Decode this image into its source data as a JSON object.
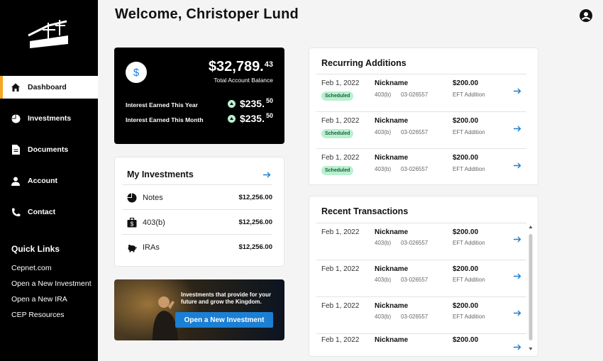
{
  "header": {
    "title": "Welcome, Christoper Lund"
  },
  "sidebar": {
    "items": [
      {
        "label": "Dashboard",
        "icon": "home-icon"
      },
      {
        "label": "Investments",
        "icon": "pie-chart-icon"
      },
      {
        "label": "Documents",
        "icon": "document-icon"
      },
      {
        "label": "Account",
        "icon": "user-icon"
      },
      {
        "label": "Contact",
        "icon": "phone-icon"
      }
    ],
    "quick_links_title": "Quick Links",
    "quick_links": [
      "Cepnet.com",
      "Open a New Investment",
      "Open a New IRA",
      "CEP Resources"
    ]
  },
  "balance": {
    "amount_main": "$32,789.",
    "amount_cents": "43",
    "label": "Total Account Balance",
    "year_label": "Interest Earned This Year",
    "year_main": "$235.",
    "year_cents": "50",
    "month_label": "Interest Earned This Month",
    "month_main": "$235.",
    "month_cents": "50"
  },
  "investments": {
    "title": "My Investments",
    "rows": [
      {
        "label": "Notes",
        "value": "$12,256.00",
        "icon": "pie-chart-icon"
      },
      {
        "label": "403(b)",
        "value": "$12,256.00",
        "icon": "briefcase-dollar-icon"
      },
      {
        "label": "IRAs",
        "value": "$12,256.00",
        "icon": "piggy-bank-icon"
      }
    ]
  },
  "promo": {
    "text": "Investments that provide for your future and grow the Kingdom.",
    "button": "Open a New Investment"
  },
  "recurring": {
    "title": "Recurring Additions",
    "rows": [
      {
        "date": "Feb 1, 2022",
        "badge": "Scheduled",
        "nickname": "Nickname",
        "account_type": "403(b)",
        "account_number": "03-026557",
        "amount": "$200.00",
        "type": "EFT Addition"
      },
      {
        "date": "Feb 1, 2022",
        "badge": "Scheduled",
        "nickname": "Nickname",
        "account_type": "403(b)",
        "account_number": "03-026557",
        "amount": "$200.00",
        "type": "EFT Addition"
      },
      {
        "date": "Feb 1, 2022",
        "badge": "Scheduled",
        "nickname": "Nickname",
        "account_type": "403(b)",
        "account_number": "03-026557",
        "amount": "$200.00",
        "type": "EFT Addition"
      }
    ]
  },
  "recent": {
    "title": "Recent Transactions",
    "rows": [
      {
        "date": "Feb 1, 2022",
        "nickname": "Nickname",
        "account_type": "403(b)",
        "account_number": "03-026557",
        "amount": "$200.00",
        "type": "EFT Addition"
      },
      {
        "date": "Feb 1, 2022",
        "nickname": "Nickname",
        "account_type": "403(b)",
        "account_number": "03-026557",
        "amount": "$200.00",
        "type": "EFT Addition"
      },
      {
        "date": "Feb 1, 2022",
        "nickname": "Nickname",
        "account_type": "403(b)",
        "account_number": "03-026557",
        "amount": "$200.00",
        "type": "EFT Addition"
      },
      {
        "date": "Feb 1, 2022",
        "nickname": "Nickname",
        "account_type": "",
        "account_number": "",
        "amount": "$200.00",
        "type": ""
      }
    ]
  },
  "colors": {
    "accent": "#1b7fd4",
    "active_marker": "#f5a623",
    "badge_bg": "#b9f0d0",
    "sidebar_bg": "#000000"
  }
}
